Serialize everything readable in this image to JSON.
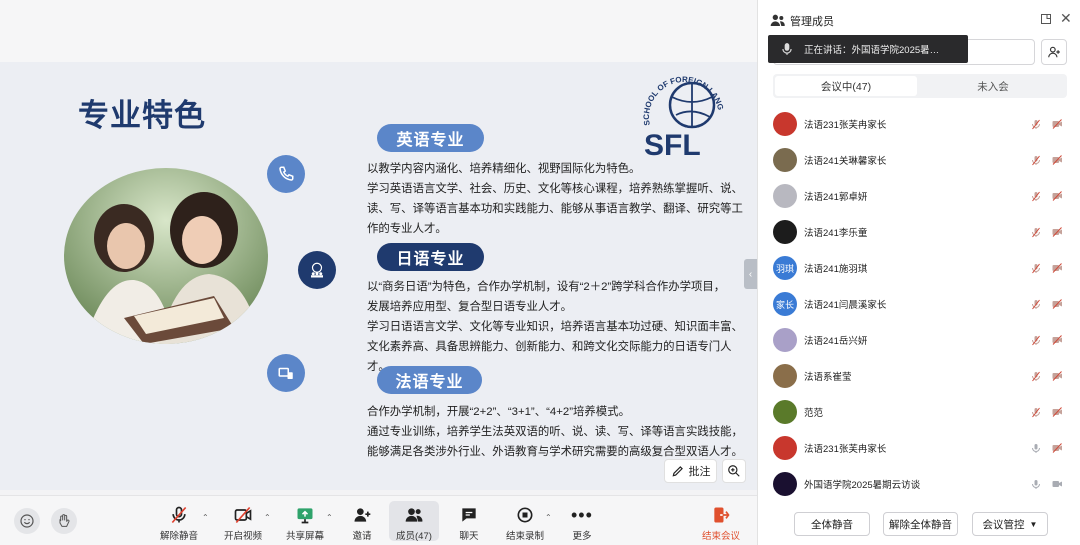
{
  "slide": {
    "title": "专业特色",
    "logo_letters": "SFL",
    "logo_arc": "SCHOOL OF FOREIGN LANGUAGES",
    "sections": [
      {
        "heading": "英语专业",
        "lines": [
          "以教学内容内涵化、培养精细化、视野国际化为特色。",
          "学习英语语言文学、社会、历史、文化等核心课程，培养熟练掌握听、说、",
          "读、写、译等语言基本功和实践能力、能够从事语言教学、翻译、研究等工",
          "作的专业人才。"
        ]
      },
      {
        "heading": "日语专业",
        "lines": [
          "以“商务日语”为特色，合作办学机制，设有“2＋2”跨学科合作办学项目，",
          "发展培养应用型、复合型日语专业人才。",
          "学习日语语言文学、文化等专业知识，培养语言基本功过硬、知识面丰富、",
          "文化素养高、具备思辨能力、创新能力、和跨文化交际能力的日语专门人才。"
        ]
      },
      {
        "heading": "法语专业",
        "lines": [
          "合作办学机制，开展“2+2”、“3+1”、“4+2”培养模式。",
          "通过专业训练，培养学生法英双语的听、说、读、写、译等语言实践技能，",
          "能够满足各类涉外行业、外语教育与学术研究需要的高级复合型双语人才。"
        ]
      }
    ],
    "annotate_label": "批注"
  },
  "toolbar": {
    "unmute": "解除静音",
    "start_video": "开启视频",
    "share_screen": "共享屏幕",
    "invite": "邀请",
    "members": "成员(47)",
    "chat": "聊天",
    "end_record": "结束录制",
    "more": "更多",
    "end_meeting": "结束会议"
  },
  "panel": {
    "title": "管理成员",
    "speaking": "正在讲话：外国语学院2025暑…",
    "tab_in": "会议中(47)",
    "tab_out": "未入会",
    "members": [
      {
        "name": "法语231张芙冉家长",
        "avatar": ""
      },
      {
        "name": "法语241关琳馨家长",
        "avatar": ""
      },
      {
        "name": "法语241郭卓妍",
        "avatar": ""
      },
      {
        "name": "法语241李乐童",
        "avatar": ""
      },
      {
        "name": "法语241施羽琪",
        "avatar": "羽琪"
      },
      {
        "name": "法语241闫晨溪家长",
        "avatar": "家长"
      },
      {
        "name": "法语241岳兴妍",
        "avatar": ""
      },
      {
        "name": "法语系崔莹",
        "avatar": ""
      },
      {
        "name": "范范",
        "avatar": ""
      },
      {
        "name": "法语231张芙冉家长",
        "avatar": ""
      },
      {
        "name": "外国语学院2025暑期云访谈",
        "avatar": ""
      }
    ],
    "mute_all": "全体静音",
    "unmute_all": "解除全体静音",
    "controls": "会议管控"
  },
  "colors": {
    "accent": "#1f3a6e",
    "pill": "#5b86c9",
    "pill_dark": "#1f3a6e",
    "danger": "#e0502e"
  }
}
